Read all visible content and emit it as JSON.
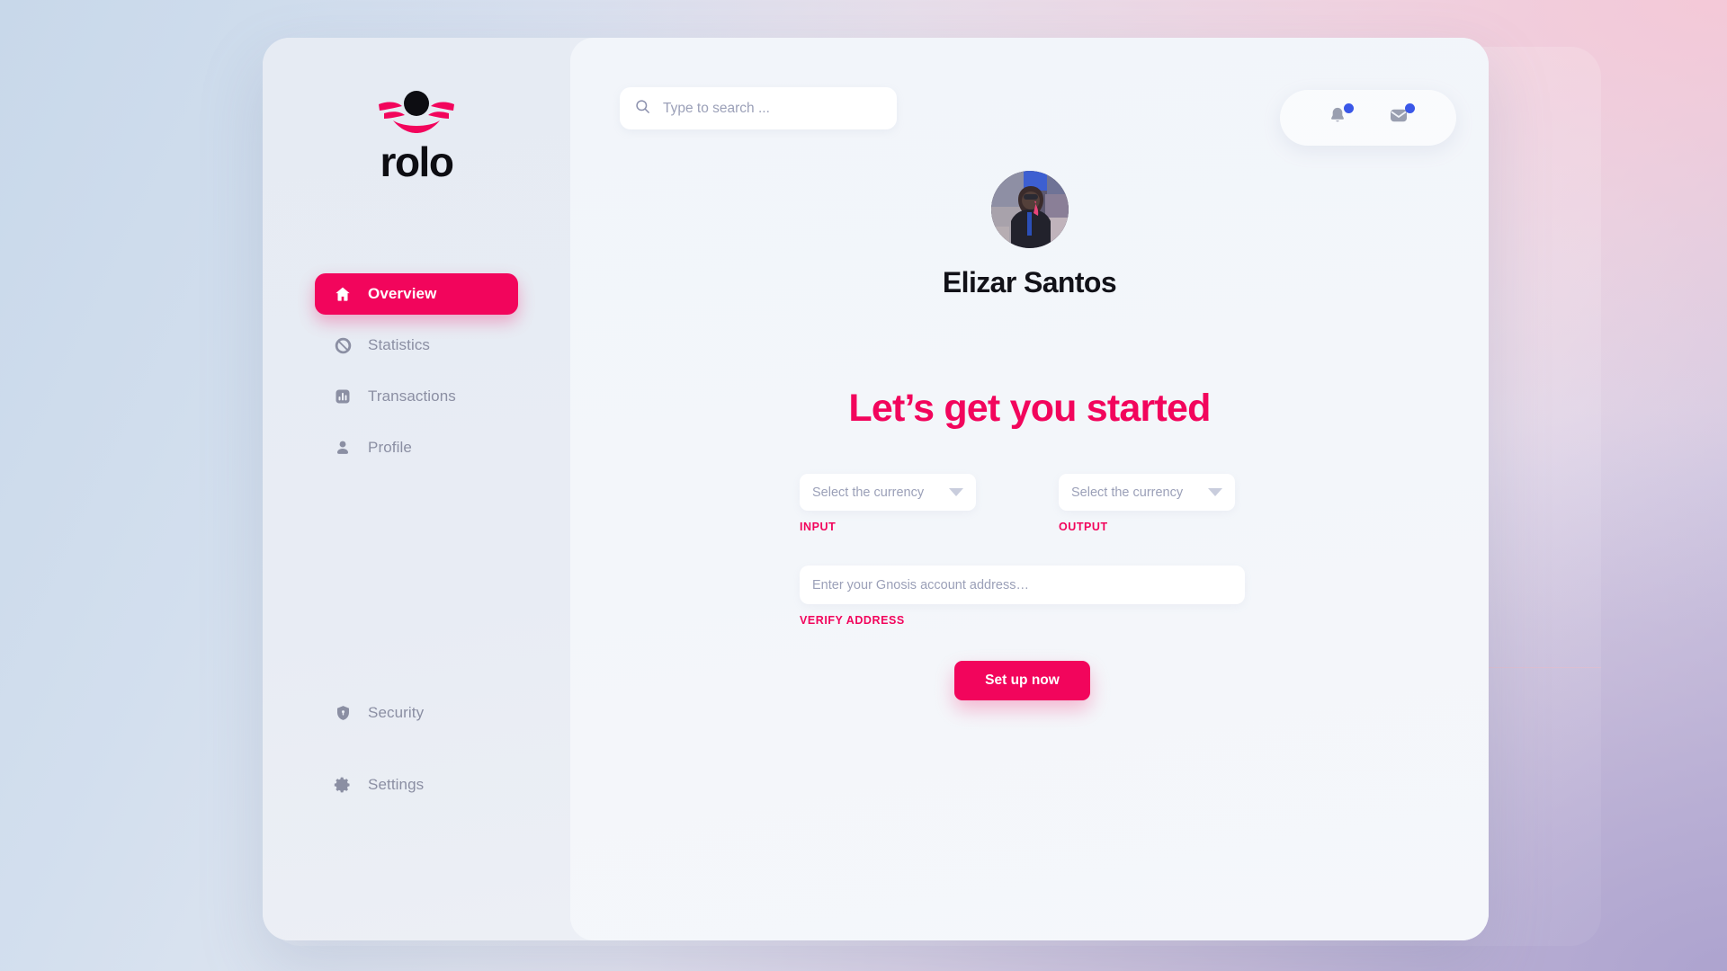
{
  "brand": {
    "name": "rolo",
    "mark": "rolo-logo-mark",
    "accent": "#f2055c"
  },
  "search": {
    "placeholder": "Type to search ...",
    "value": "",
    "icon": "search-icon"
  },
  "topbar": {
    "notifications": {
      "icon": "bell-icon",
      "badge": true,
      "badge_color": "#3a57e8"
    },
    "messages": {
      "icon": "mail-icon",
      "badge": true,
      "badge_color": "#3a57e8"
    }
  },
  "sidebar": {
    "primary_items": [
      {
        "label": "Overview",
        "icon": "home-icon",
        "active": true
      },
      {
        "label": "Statistics",
        "icon": "statistics-icon",
        "active": false
      },
      {
        "label": "Transactions",
        "icon": "transactions-icon",
        "active": false
      },
      {
        "label": "Profile",
        "icon": "person-icon",
        "active": false
      }
    ],
    "secondary_items": [
      {
        "label": "Security",
        "icon": "shield-lock-icon"
      },
      {
        "label": "Settings",
        "icon": "gear-icon"
      }
    ]
  },
  "profile": {
    "name": "Elizar Santos",
    "avatar": "user-photo-avatar"
  },
  "main": {
    "headline": "Let’s get you started",
    "fields": {
      "input_currency": {
        "placeholder": "Select the currency",
        "value": "",
        "label": "INPUT",
        "caret": "chevron-down-icon"
      },
      "output_currency": {
        "placeholder": "Select the currency",
        "value": "",
        "label": "OUTPUT",
        "caret": "chevron-down-icon"
      },
      "account_address": {
        "placeholder": "Enter your Gnosis account address…",
        "value": "",
        "label": "VERIFY ADDRESS"
      }
    },
    "cta_label": "Set up now"
  }
}
